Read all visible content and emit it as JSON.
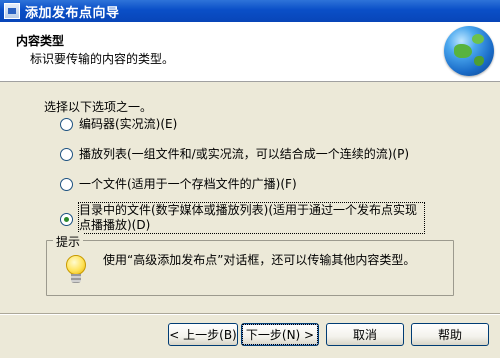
{
  "window": {
    "title": "添加发布点向导"
  },
  "header": {
    "title": "内容类型",
    "subtitle": "标识要传输的内容的类型。"
  },
  "prompt": "选择以下选项之一。",
  "options": [
    {
      "label": "编码器(实况流)(E)",
      "selected": false
    },
    {
      "label": "播放列表(一组文件和/或实况流，可以结合成一个连续的流)(P)",
      "selected": false
    },
    {
      "label": "一个文件(适用于一个存档文件的广播)(F)",
      "selected": false
    },
    {
      "label": "目录中的文件(数字媒体或播放列表)(适用于通过一个发布点实现点播播放)(D)",
      "selected": true
    }
  ],
  "tip": {
    "legend": "提示",
    "text": "使用“高级添加发布点”对话框，还可以传输其他内容类型。",
    "icon": "lightbulb-icon"
  },
  "buttons": {
    "back": "< 上一步(B)",
    "next": "下一步(N) >",
    "cancel": "取消",
    "help": "帮助"
  },
  "colors": {
    "titlebar": "#0a4fc7",
    "dialog_bg": "#ece9d8",
    "radio_dot": "#2b8a2b"
  }
}
